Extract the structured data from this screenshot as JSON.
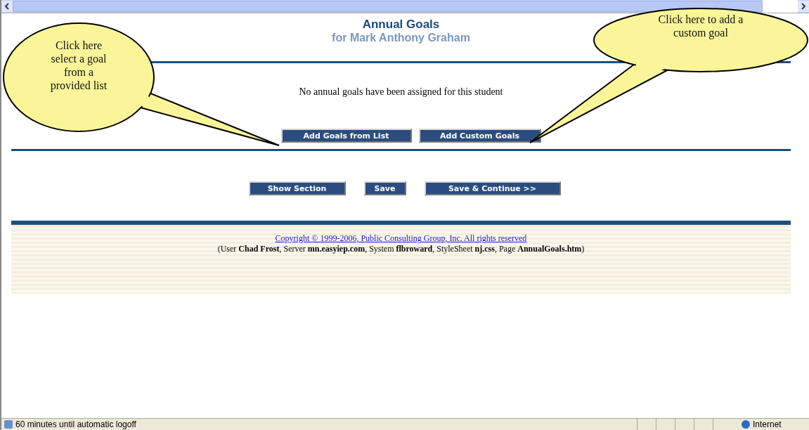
{
  "header": {
    "title": "Annual Goals",
    "subtitle": "for Mark Anthony Graham"
  },
  "message": "No annual goals have been assigned for this student",
  "goal_buttons": [
    "Add Goals from List",
    "Add Custom Goals"
  ],
  "action_buttons": [
    "Show Section",
    "Save",
    "Save & Continue >>"
  ],
  "footer": {
    "copyright": "Copyright © 1999-2006, Public Consulting Group, Inc. All rights reserved",
    "info": "(User **Chad Frost**, Server **mn.easyiep.com**, System **flbroward**, StyleSheet **nj.css**, Page **AnnualGoals.htm**)"
  },
  "callouts": [
    {
      "text": "Click here select a goal from a provided list"
    },
    {
      "text": "Click here to add a custom goal"
    }
  ],
  "status_bar": {
    "message": "60 minutes until automatic logoff",
    "zone": "Internet"
  }
}
